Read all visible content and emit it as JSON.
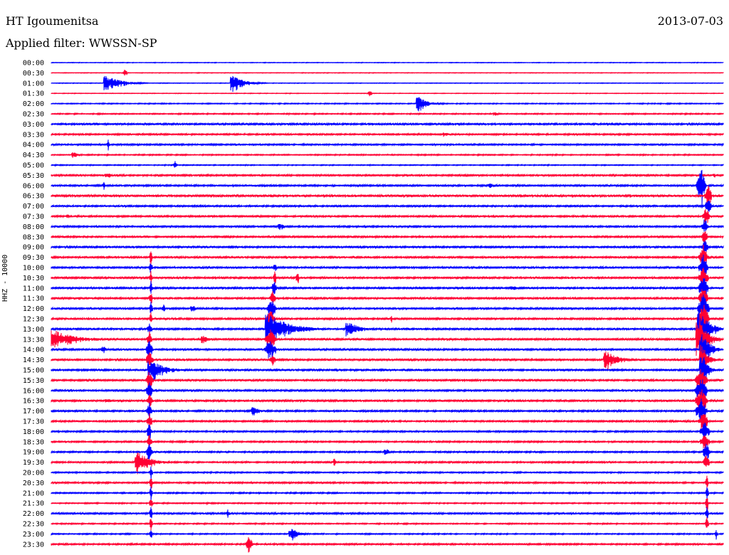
{
  "header": {
    "station": "HT Igoumenitsa",
    "date": "2013-07-03",
    "filter": "Applied filter: WWSSN-SP",
    "channel": "HHZ - 10000"
  },
  "colors": {
    "trace_a": "#0000ff",
    "trace_b": "#ff0033",
    "text": "#000000"
  },
  "traces": [
    {
      "label": "00:00",
      "color": "a",
      "noise": 0.3,
      "events": []
    },
    {
      "label": "00:30",
      "color": "b",
      "noise": 0.3,
      "events": [
        {
          "t": 176,
          "amp": 6,
          "dur": 4,
          "kind": "spike"
        }
      ]
    },
    {
      "label": "01:00",
      "color": "a",
      "noise": 0.3,
      "events": [
        {
          "t": 148,
          "amp": 10,
          "dur": 60,
          "kind": "quake"
        },
        {
          "t": 326,
          "amp": 10,
          "dur": 50,
          "kind": "quake"
        }
      ]
    },
    {
      "label": "01:30",
      "color": "b",
      "noise": 0.3,
      "events": [
        {
          "t": 520,
          "amp": 4,
          "dur": 4,
          "kind": "spike"
        }
      ]
    },
    {
      "label": "02:00",
      "color": "a",
      "noise": 0.5,
      "events": [
        {
          "t": 587,
          "amp": 9,
          "dur": 35,
          "kind": "quake"
        }
      ]
    },
    {
      "label": "02:30",
      "color": "b",
      "noise": 0.6,
      "events": [
        {
          "t": 695,
          "amp": 2,
          "dur": 20,
          "kind": "quake"
        }
      ]
    },
    {
      "label": "03:00",
      "color": "a",
      "noise": 1.0,
      "events": []
    },
    {
      "label": "03:30",
      "color": "b",
      "noise": 0.8,
      "events": [
        {
          "t": 625,
          "amp": 3,
          "dur": 15,
          "kind": "quake"
        }
      ]
    },
    {
      "label": "04:00",
      "color": "a",
      "noise": 0.8,
      "events": [
        {
          "t": 152,
          "amp": 7,
          "dur": 3,
          "kind": "spike"
        }
      ]
    },
    {
      "label": "04:30",
      "color": "b",
      "noise": 0.6,
      "events": [
        {
          "t": 103,
          "amp": 4,
          "dur": 15,
          "kind": "quake"
        }
      ]
    },
    {
      "label": "05:00",
      "color": "a",
      "noise": 0.5,
      "events": [
        {
          "t": 246,
          "amp": 6,
          "dur": 3,
          "kind": "spike"
        }
      ]
    },
    {
      "label": "05:30",
      "color": "b",
      "noise": 0.9,
      "events": [
        {
          "t": 150,
          "amp": 3,
          "dur": 15,
          "kind": "quake"
        },
        {
          "t": 1003,
          "amp": 3,
          "dur": 4,
          "kind": "spike"
        }
      ]
    },
    {
      "label": "06:00",
      "color": "a",
      "noise": 0.9,
      "events": [
        {
          "t": 146,
          "amp": 5,
          "dur": 3,
          "kind": "spike"
        },
        {
          "t": 688,
          "amp": 3,
          "dur": 10,
          "kind": "quake"
        },
        {
          "t": 985,
          "amp": 28,
          "dur": 8,
          "kind": "spike"
        }
      ]
    },
    {
      "label": "06:30",
      "color": "b",
      "noise": 1.2,
      "events": [
        {
          "t": 995,
          "amp": 16,
          "dur": 6,
          "kind": "spike"
        }
      ]
    },
    {
      "label": "07:00",
      "color": "a",
      "noise": 0.9,
      "events": [
        {
          "t": 995,
          "amp": 12,
          "dur": 6,
          "kind": "spike"
        }
      ]
    },
    {
      "label": "07:30",
      "color": "b",
      "noise": 0.9,
      "events": [
        {
          "t": 95,
          "amp": 5,
          "dur": 3,
          "kind": "spike"
        },
        {
          "t": 992,
          "amp": 14,
          "dur": 6,
          "kind": "spike"
        }
      ]
    },
    {
      "label": "08:00",
      "color": "a",
      "noise": 0.9,
      "events": [
        {
          "t": 393,
          "amp": 4,
          "dur": 12,
          "kind": "quake"
        },
        {
          "t": 990,
          "amp": 12,
          "dur": 6,
          "kind": "spike"
        }
      ]
    },
    {
      "label": "08:30",
      "color": "b",
      "noise": 0.9,
      "events": [
        {
          "t": 990,
          "amp": 10,
          "dur": 6,
          "kind": "spike"
        }
      ]
    },
    {
      "label": "09:00",
      "color": "a",
      "noise": 1.0,
      "events": [
        {
          "t": 990,
          "amp": 12,
          "dur": 6,
          "kind": "spike"
        }
      ]
    },
    {
      "label": "09:30",
      "color": "b",
      "noise": 1.0,
      "events": [
        {
          "t": 212,
          "amp": 10,
          "dur": 3,
          "kind": "spike"
        },
        {
          "t": 988,
          "amp": 20,
          "dur": 8,
          "kind": "spike"
        }
      ]
    },
    {
      "label": "10:00",
      "color": "a",
      "noise": 1.0,
      "events": [
        {
          "t": 212,
          "amp": 10,
          "dur": 3,
          "kind": "spike"
        },
        {
          "t": 386,
          "amp": 8,
          "dur": 3,
          "kind": "spike"
        },
        {
          "t": 988,
          "amp": 20,
          "dur": 8,
          "kind": "spike"
        }
      ]
    },
    {
      "label": "10:30",
      "color": "b",
      "noise": 1.0,
      "events": [
        {
          "t": 212,
          "amp": 10,
          "dur": 3,
          "kind": "spike"
        },
        {
          "t": 386,
          "amp": 10,
          "dur": 3,
          "kind": "spike"
        },
        {
          "t": 418,
          "amp": 8,
          "dur": 3,
          "kind": "spike"
        },
        {
          "t": 988,
          "amp": 18,
          "dur": 8,
          "kind": "spike"
        }
      ]
    },
    {
      "label": "11:00",
      "color": "a",
      "noise": 1.0,
      "events": [
        {
          "t": 212,
          "amp": 10,
          "dur": 3,
          "kind": "spike"
        },
        {
          "t": 385,
          "amp": 12,
          "dur": 5,
          "kind": "spike"
        },
        {
          "t": 720,
          "amp": 3,
          "dur": 8,
          "kind": "quake"
        },
        {
          "t": 988,
          "amp": 20,
          "dur": 8,
          "kind": "spike"
        }
      ]
    },
    {
      "label": "11:30",
      "color": "b",
      "noise": 1.0,
      "events": [
        {
          "t": 212,
          "amp": 10,
          "dur": 3,
          "kind": "spike"
        },
        {
          "t": 383,
          "amp": 12,
          "dur": 5,
          "kind": "spike"
        },
        {
          "t": 988,
          "amp": 18,
          "dur": 8,
          "kind": "spike"
        }
      ]
    },
    {
      "label": "12:00",
      "color": "a",
      "noise": 1.0,
      "events": [
        {
          "t": 212,
          "amp": 10,
          "dur": 3,
          "kind": "spike"
        },
        {
          "t": 230,
          "amp": 8,
          "dur": 3,
          "kind": "spike"
        },
        {
          "t": 270,
          "amp": 4,
          "dur": 6,
          "kind": "quake"
        },
        {
          "t": 382,
          "amp": 14,
          "dur": 8,
          "kind": "spike"
        },
        {
          "t": 988,
          "amp": 22,
          "dur": 10,
          "kind": "spike"
        }
      ]
    },
    {
      "label": "12:30",
      "color": "b",
      "noise": 1.0,
      "events": [
        {
          "t": 212,
          "amp": 10,
          "dur": 3,
          "kind": "spike"
        },
        {
          "t": 380,
          "amp": 14,
          "dur": 8,
          "kind": "spike"
        },
        {
          "t": 550,
          "amp": 4,
          "dur": 3,
          "kind": "spike"
        },
        {
          "t": 988,
          "amp": 24,
          "dur": 10,
          "kind": "spike"
        }
      ]
    },
    {
      "label": "13:00",
      "color": "a",
      "noise": 1.0,
      "events": [
        {
          "t": 210,
          "amp": 12,
          "dur": 4,
          "kind": "spike"
        },
        {
          "t": 375,
          "amp": 22,
          "dur": 80,
          "kind": "quake"
        },
        {
          "t": 488,
          "amp": 10,
          "dur": 40,
          "kind": "quake"
        },
        {
          "t": 982,
          "amp": 26,
          "dur": 36,
          "kind": "quake"
        }
      ]
    },
    {
      "label": "13:30",
      "color": "b",
      "noise": 1.0,
      "events": [
        {
          "t": 72,
          "amp": 14,
          "dur": 80,
          "kind": "quake"
        },
        {
          "t": 210,
          "amp": 12,
          "dur": 4,
          "kind": "spike"
        },
        {
          "t": 285,
          "amp": 5,
          "dur": 25,
          "kind": "quake"
        },
        {
          "t": 380,
          "amp": 16,
          "dur": 10,
          "kind": "spike"
        },
        {
          "t": 980,
          "amp": 26,
          "dur": 36,
          "kind": "quake"
        }
      ]
    },
    {
      "label": "14:00",
      "color": "a",
      "noise": 1.0,
      "events": [
        {
          "t": 145,
          "amp": 4,
          "dur": 8,
          "kind": "quake"
        },
        {
          "t": 210,
          "amp": 14,
          "dur": 6,
          "kind": "spike"
        },
        {
          "t": 380,
          "amp": 14,
          "dur": 10,
          "kind": "spike"
        },
        {
          "t": 985,
          "amp": 22,
          "dur": 30,
          "kind": "quake"
        }
      ]
    },
    {
      "label": "14:30",
      "color": "b",
      "noise": 1.0,
      "events": [
        {
          "t": 210,
          "amp": 14,
          "dur": 6,
          "kind": "spike"
        },
        {
          "t": 383,
          "amp": 10,
          "dur": 6,
          "kind": "spike"
        },
        {
          "t": 850,
          "amp": 12,
          "dur": 50,
          "kind": "quake"
        },
        {
          "t": 985,
          "amp": 22,
          "dur": 20,
          "kind": "quake"
        }
      ]
    },
    {
      "label": "15:00",
      "color": "a",
      "noise": 1.0,
      "events": [
        {
          "t": 210,
          "amp": 14,
          "dur": 55,
          "kind": "quake"
        },
        {
          "t": 985,
          "amp": 22,
          "dur": 20,
          "kind": "quake"
        }
      ]
    },
    {
      "label": "15:30",
      "color": "b",
      "noise": 1.0,
      "events": [
        {
          "t": 210,
          "amp": 14,
          "dur": 6,
          "kind": "spike"
        },
        {
          "t": 985,
          "amp": 20,
          "dur": 10,
          "kind": "spike"
        }
      ]
    },
    {
      "label": "16:00",
      "color": "a",
      "noise": 1.0,
      "events": [
        {
          "t": 210,
          "amp": 14,
          "dur": 6,
          "kind": "spike"
        },
        {
          "t": 985,
          "amp": 20,
          "dur": 10,
          "kind": "spike"
        }
      ]
    },
    {
      "label": "16:30",
      "color": "b",
      "noise": 1.0,
      "events": [
        {
          "t": 150,
          "amp": 3,
          "dur": 10,
          "kind": "quake"
        },
        {
          "t": 210,
          "amp": 12,
          "dur": 5,
          "kind": "spike"
        },
        {
          "t": 985,
          "amp": 18,
          "dur": 10,
          "kind": "spike"
        }
      ]
    },
    {
      "label": "17:00",
      "color": "a",
      "noise": 0.9,
      "events": [
        {
          "t": 210,
          "amp": 12,
          "dur": 5,
          "kind": "spike"
        },
        {
          "t": 355,
          "amp": 6,
          "dur": 18,
          "kind": "quake"
        },
        {
          "t": 985,
          "amp": 18,
          "dur": 10,
          "kind": "spike"
        }
      ]
    },
    {
      "label": "17:30",
      "color": "b",
      "noise": 0.9,
      "events": [
        {
          "t": 210,
          "amp": 12,
          "dur": 5,
          "kind": "spike"
        },
        {
          "t": 988,
          "amp": 16,
          "dur": 8,
          "kind": "spike"
        }
      ]
    },
    {
      "label": "18:00",
      "color": "a",
      "noise": 0.8,
      "events": [
        {
          "t": 210,
          "amp": 12,
          "dur": 5,
          "kind": "spike"
        },
        {
          "t": 990,
          "amp": 16,
          "dur": 8,
          "kind": "spike"
        }
      ]
    },
    {
      "label": "18:30",
      "color": "b",
      "noise": 0.8,
      "events": [
        {
          "t": 210,
          "amp": 12,
          "dur": 5,
          "kind": "spike"
        },
        {
          "t": 990,
          "amp": 14,
          "dur": 8,
          "kind": "spike"
        }
      ]
    },
    {
      "label": "19:00",
      "color": "a",
      "noise": 0.8,
      "events": [
        {
          "t": 210,
          "amp": 12,
          "dur": 5,
          "kind": "spike"
        },
        {
          "t": 542,
          "amp": 4,
          "dur": 6,
          "kind": "quake"
        },
        {
          "t": 992,
          "amp": 14,
          "dur": 6,
          "kind": "spike"
        }
      ]
    },
    {
      "label": "19:30",
      "color": "b",
      "noise": 0.8,
      "events": [
        {
          "t": 192,
          "amp": 14,
          "dur": 50,
          "kind": "quake"
        },
        {
          "t": 470,
          "amp": 8,
          "dur": 3,
          "kind": "spike"
        },
        {
          "t": 992,
          "amp": 10,
          "dur": 6,
          "kind": "spike"
        }
      ]
    },
    {
      "label": "20:00",
      "color": "a",
      "noise": 0.7,
      "events": [
        {
          "t": 212,
          "amp": 10,
          "dur": 3,
          "kind": "spike"
        }
      ]
    },
    {
      "label": "20:30",
      "color": "b",
      "noise": 0.8,
      "events": [
        {
          "t": 212,
          "amp": 10,
          "dur": 3,
          "kind": "spike"
        },
        {
          "t": 993,
          "amp": 10,
          "dur": 3,
          "kind": "spike"
        }
      ]
    },
    {
      "label": "21:00",
      "color": "a",
      "noise": 0.7,
      "events": [
        {
          "t": 212,
          "amp": 10,
          "dur": 3,
          "kind": "spike"
        },
        {
          "t": 993,
          "amp": 10,
          "dur": 3,
          "kind": "spike"
        }
      ]
    },
    {
      "label": "21:30",
      "color": "b",
      "noise": 0.6,
      "events": [
        {
          "t": 212,
          "amp": 10,
          "dur": 3,
          "kind": "spike"
        },
        {
          "t": 993,
          "amp": 10,
          "dur": 3,
          "kind": "spike"
        }
      ]
    },
    {
      "label": "22:00",
      "color": "a",
      "noise": 0.9,
      "events": [
        {
          "t": 212,
          "amp": 10,
          "dur": 3,
          "kind": "spike"
        },
        {
          "t": 320,
          "amp": 6,
          "dur": 3,
          "kind": "spike"
        },
        {
          "t": 993,
          "amp": 10,
          "dur": 3,
          "kind": "spike"
        }
      ]
    },
    {
      "label": "22:30",
      "color": "b",
      "noise": 0.6,
      "events": [
        {
          "t": 212,
          "amp": 10,
          "dur": 3,
          "kind": "spike"
        },
        {
          "t": 993,
          "amp": 10,
          "dur": 3,
          "kind": "spike"
        }
      ]
    },
    {
      "label": "23:00",
      "color": "a",
      "noise": 0.6,
      "events": [
        {
          "t": 212,
          "amp": 8,
          "dur": 3,
          "kind": "spike"
        },
        {
          "t": 408,
          "amp": 9,
          "dur": 25,
          "kind": "quake"
        },
        {
          "t": 1006,
          "amp": 6,
          "dur": 3,
          "kind": "spike"
        }
      ]
    },
    {
      "label": "23:30",
      "color": "b",
      "noise": 0.8,
      "events": [
        {
          "t": 350,
          "amp": 14,
          "dur": 6,
          "kind": "spike"
        }
      ]
    }
  ]
}
